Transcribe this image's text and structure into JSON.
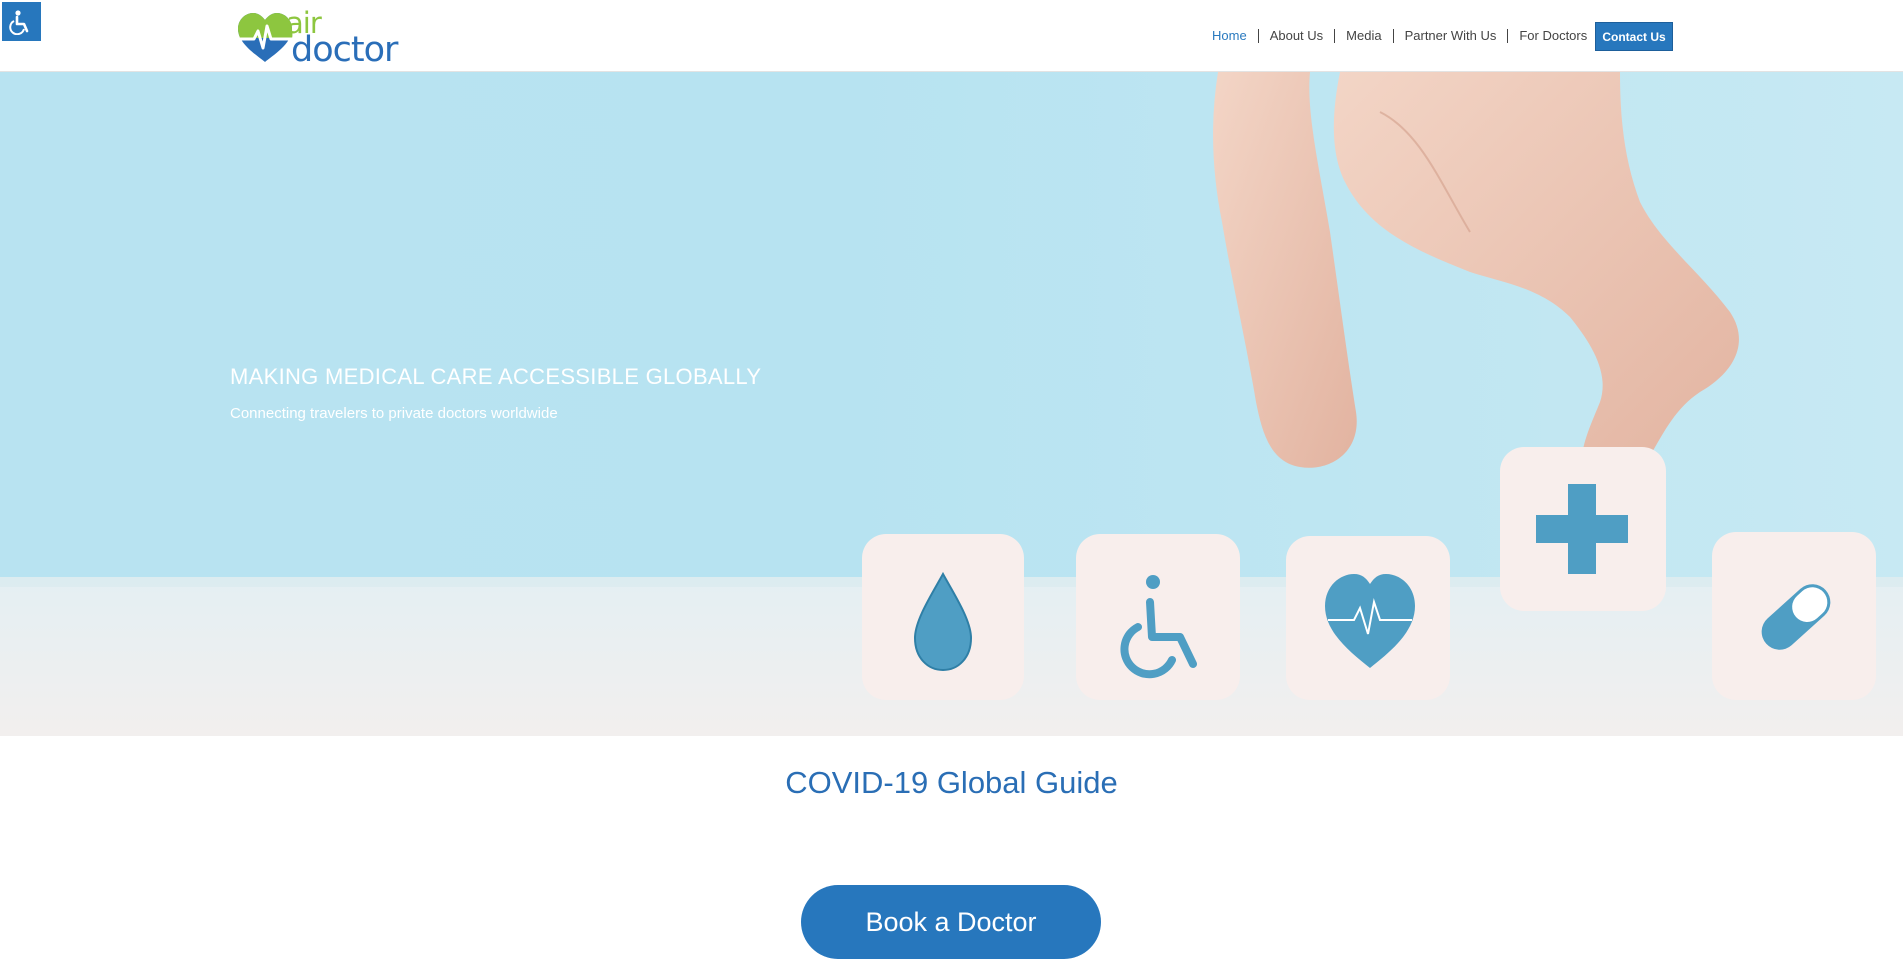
{
  "accessibility": {
    "icon": "wheelchair-icon"
  },
  "logo": {
    "word1": "air",
    "word2": "doctor",
    "icon": "heart-pulse-icon"
  },
  "nav": {
    "items": [
      {
        "label": "Home",
        "active": true
      },
      {
        "label": "About Us"
      },
      {
        "label": "Media"
      },
      {
        "label": "Partner With Us"
      },
      {
        "label": "For Doctors"
      }
    ],
    "contact_label": "Contact Us"
  },
  "hero": {
    "title": "MAKING MEDICAL CARE ACCESSIBLE GLOBALLY",
    "subtitle": "Connecting travelers to private doctors worldwide",
    "dice_icons": [
      "drop-icon",
      "wheelchair-icon",
      "heart-pulse-icon",
      "cross-icon",
      "pill-icon"
    ]
  },
  "guide_link": "COVID-19 Global Guide",
  "book_button": "Book a Doctor",
  "colors": {
    "primary": "#2777bd",
    "logo_green": "#8dc63f",
    "logo_blue": "#2a6eb8",
    "hero_sky": "#b8e3f1"
  }
}
